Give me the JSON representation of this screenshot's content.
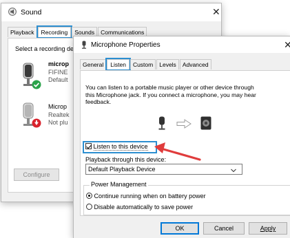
{
  "sound_window": {
    "title": "Sound",
    "tabs": [
      {
        "label": "Playback"
      },
      {
        "label": "Recording"
      },
      {
        "label": "Sounds"
      },
      {
        "label": "Communications"
      }
    ],
    "prompt": "Select a recording de",
    "devices": [
      {
        "name": "microp",
        "line2": "FIFINE",
        "line3": "Default",
        "status": "default"
      },
      {
        "name": "Microp",
        "line2": "Realtek",
        "line3": "Not plu",
        "status": "unplugged"
      }
    ],
    "configure_label": "Configure"
  },
  "mic_dialog": {
    "title": "Microphone Properties",
    "tabs": [
      {
        "label": "General"
      },
      {
        "label": "Listen"
      },
      {
        "label": "Custom"
      },
      {
        "label": "Levels"
      },
      {
        "label": "Advanced"
      }
    ],
    "description": [
      "You can listen to a portable music player or other device through",
      "this Microphone jack.  If you connect a microphone, you may hear",
      "feedback."
    ],
    "listen_checkbox_label": "Listen to this device",
    "listen_checked": true,
    "playback_label": "Playback through this device:",
    "playback_selected": "Default Playback Device",
    "power_group_label": "Power Management",
    "power_options": [
      {
        "label": "Continue running when on battery power",
        "selected": true
      },
      {
        "label": "Disable automatically to save power",
        "selected": false
      }
    ],
    "buttons": {
      "ok": "OK",
      "cancel": "Cancel",
      "apply": "Apply"
    }
  },
  "colors": {
    "highlight": "#2c8ed0",
    "arrow": "#e03c3c",
    "default_badge": "#2aa34a",
    "unplugged_badge": "#d9232d"
  }
}
